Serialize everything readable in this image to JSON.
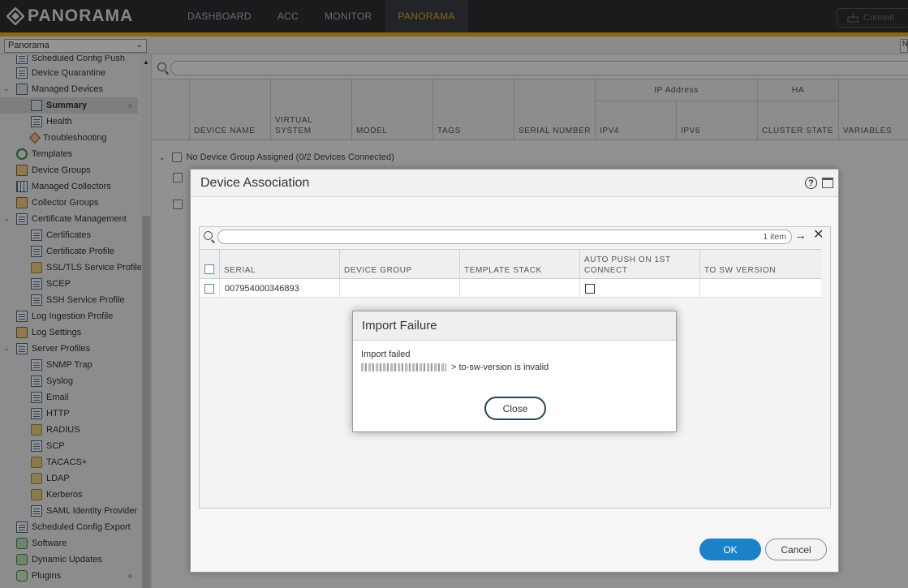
{
  "app": {
    "logo_text": "PANORAMA",
    "nav_tabs": [
      "DASHBOARD",
      "ACC",
      "MONITOR",
      "PANORAMA"
    ],
    "active_tab": "PANORAMA",
    "commit_label": "Commit",
    "accent_color": "#f2b21d"
  },
  "context": {
    "selected": "Panorama",
    "right_select_fragment": "N"
  },
  "sidebar": {
    "items": [
      {
        "label": "Scheduled Config Push",
        "icon": "doc-icon"
      },
      {
        "label": "Device Quarantine",
        "icon": "doc-icon"
      },
      {
        "label": "Managed Devices",
        "icon": "monitor-icon"
      },
      {
        "label": "Summary",
        "icon": "monitor-icon"
      },
      {
        "label": "Health",
        "icon": "doc-icon"
      },
      {
        "label": "Troubleshooting",
        "icon": "tool-icon"
      },
      {
        "label": "Templates",
        "icon": "gear-icon"
      },
      {
        "label": "Device Groups",
        "icon": "folder-icon"
      },
      {
        "label": "Managed Collectors",
        "icon": "grid-icon"
      },
      {
        "label": "Collector Groups",
        "icon": "folder-icon"
      },
      {
        "label": "Certificate Management",
        "icon": "doc-icon"
      },
      {
        "label": "Certificates",
        "icon": "doc-icon"
      },
      {
        "label": "Certificate Profile",
        "icon": "doc-icon"
      },
      {
        "label": "SSL/TLS Service Profile",
        "icon": "lock-icon"
      },
      {
        "label": "SCEP",
        "icon": "doc-icon"
      },
      {
        "label": "SSH Service Profile",
        "icon": "doc-icon"
      },
      {
        "label": "Log Ingestion Profile",
        "icon": "doc-icon"
      },
      {
        "label": "Log Settings",
        "icon": "folder-icon"
      },
      {
        "label": "Server Profiles",
        "icon": "doc-icon"
      },
      {
        "label": "SNMP Trap",
        "icon": "doc-icon"
      },
      {
        "label": "Syslog",
        "icon": "doc-icon"
      },
      {
        "label": "Email",
        "icon": "doc-icon"
      },
      {
        "label": "HTTP",
        "icon": "doc-icon"
      },
      {
        "label": "RADIUS",
        "icon": "lock-icon"
      },
      {
        "label": "SCP",
        "icon": "doc-icon"
      },
      {
        "label": "TACACS+",
        "icon": "lock-icon"
      },
      {
        "label": "LDAP",
        "icon": "lock-icon"
      },
      {
        "label": "Kerberos",
        "icon": "lock-icon"
      },
      {
        "label": "SAML Identity Provider",
        "icon": "doc-icon"
      },
      {
        "label": "Scheduled Config Export",
        "icon": "doc-icon"
      },
      {
        "label": "Software",
        "icon": "green-icon"
      },
      {
        "label": "Dynamic Updates",
        "icon": "green-icon"
      },
      {
        "label": "Plugins",
        "icon": "puzzle-icon"
      }
    ]
  },
  "main_grid": {
    "columns": [
      "DEVICE NAME",
      "VIRTUAL SYSTEM",
      "MODEL",
      "TAGS",
      "SERIAL NUMBER",
      "IPV4",
      "IPV6",
      "CLUSTER STATE",
      "VARIABLES"
    ],
    "virtual_system_line1": "VIRTUAL",
    "virtual_system_line2": "SYSTEM",
    "group_ip": "IP Address",
    "group_ha": "HA",
    "group_row": "No Device Group Assigned (0/2 Devices Connected)"
  },
  "device_association": {
    "title": "Device Association",
    "help_glyph": "?",
    "item_count": "1 item",
    "columns": [
      "SERIAL",
      "DEVICE GROUP",
      "TEMPLATE STACK",
      "TO SW VERSION"
    ],
    "auto_push_line1": "AUTO PUSH ON 1ST",
    "auto_push_line2": "CONNECT",
    "rows": [
      {
        "serial": "007954000346893",
        "device_group": "",
        "template_stack": "",
        "auto_push": false,
        "to_sw_version": ""
      }
    ],
    "ok_label": "OK",
    "cancel_label": "Cancel"
  },
  "import_failure": {
    "title": "Import Failure",
    "line1": "Import failed",
    "line2_suffix": "> to-sw-version is invalid",
    "close_label": "Close"
  }
}
